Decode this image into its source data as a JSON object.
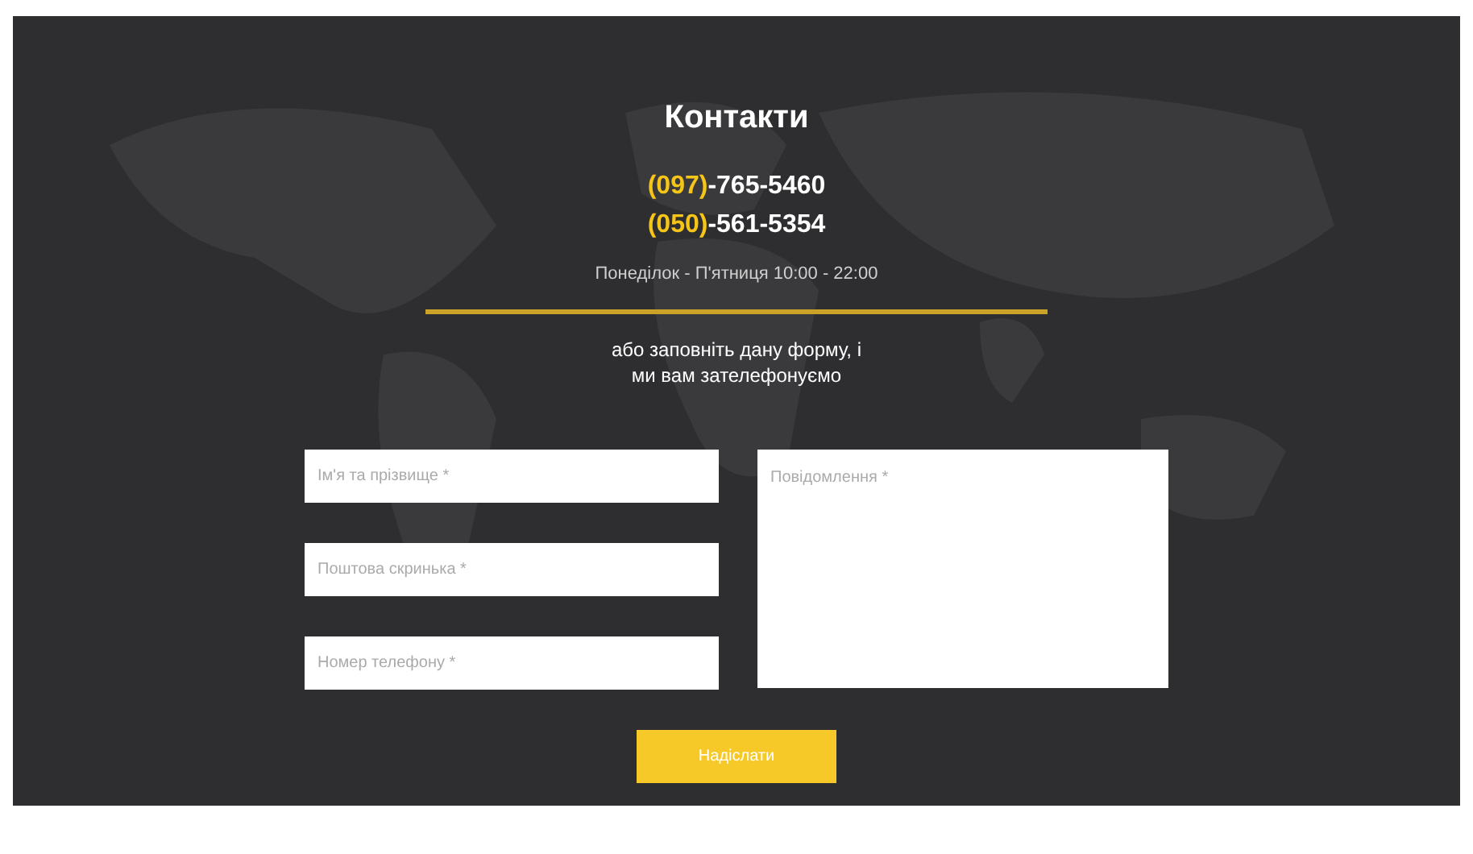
{
  "title": "Контакти",
  "phones": [
    "**(097)**-765-5460",
    "**(050)**-561-5354"
  ],
  "hours": "Понеділок - П'ятниця 10:00 - 22:00",
  "prompt": [
    "або заповніть дану форму, і",
    "ми вам зателефонуємо"
  ],
  "fields": [
    {
      "placeholder": "Ім'я та прізвище *"
    },
    {
      "placeholder": "Поштова скринька *"
    },
    {
      "placeholder": "Номер телефону *"
    }
  ],
  "message": {
    "placeholder": "Повідомлення *"
  },
  "submit": "Надіслати"
}
